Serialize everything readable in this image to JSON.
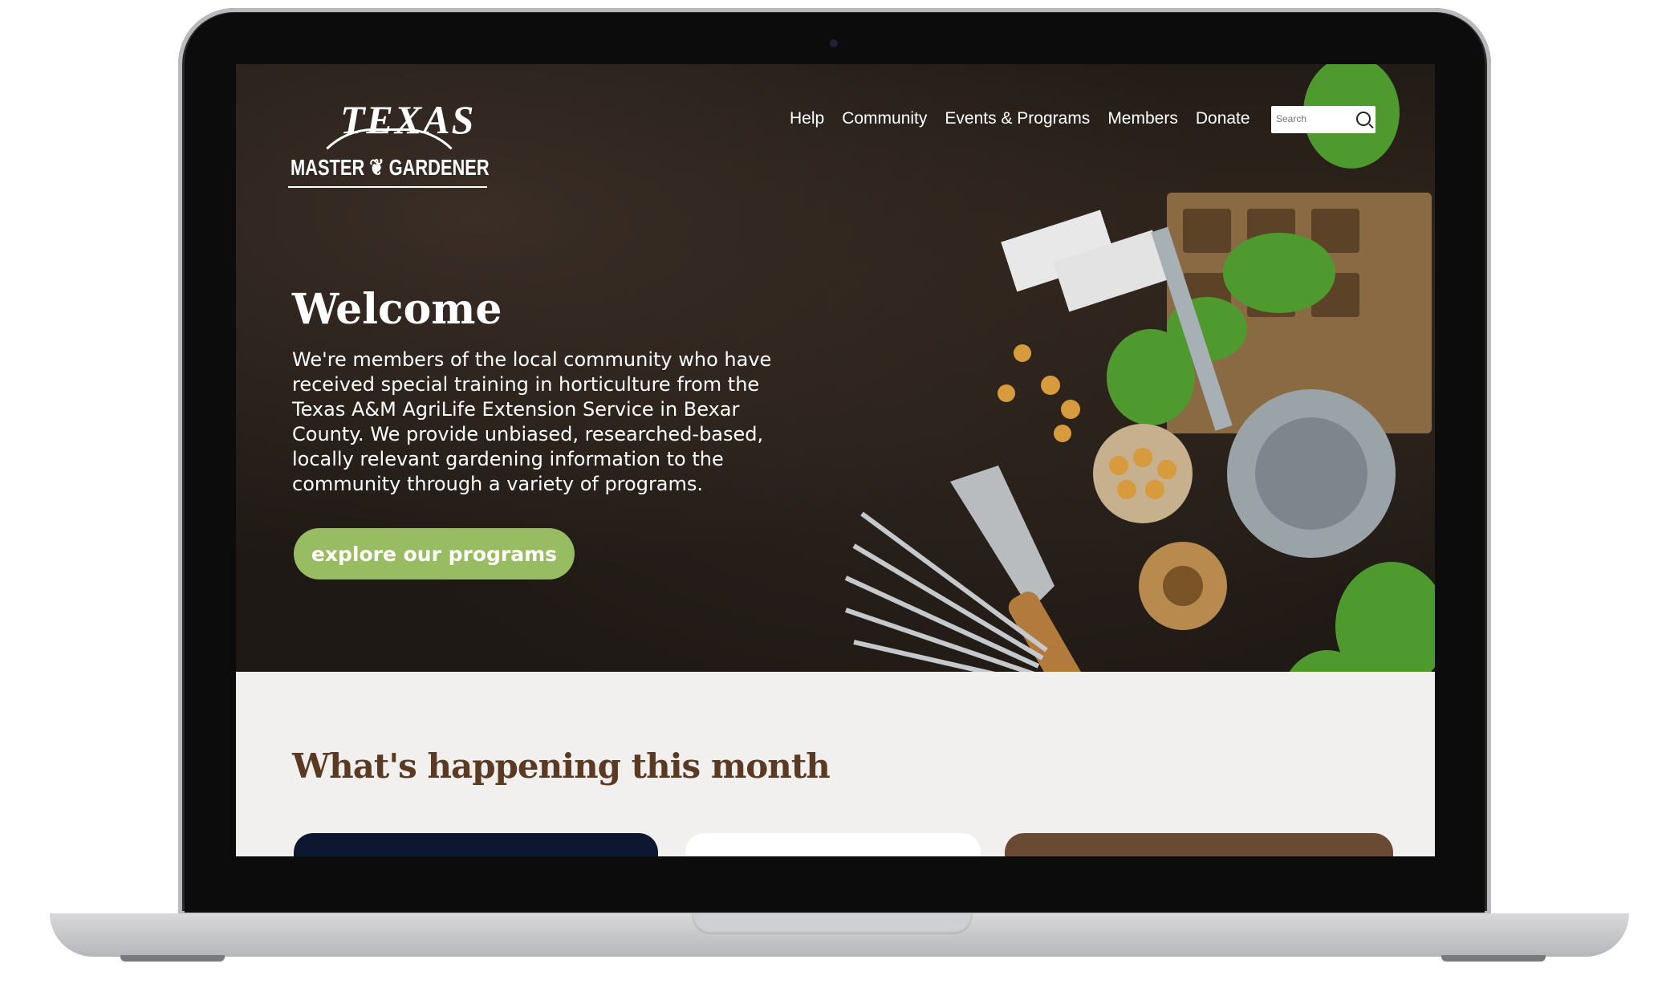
{
  "logo": {
    "top": "TEXAS",
    "bottom": "MASTER ❦ GARDENER"
  },
  "nav": {
    "items": [
      "Help",
      "Community",
      "Events & Programs",
      "Members",
      "Donate"
    ]
  },
  "search": {
    "placeholder": "Search"
  },
  "hero": {
    "title": "Welcome",
    "text": "We're members of the local community who have received special training in horticulture from the Texas A&M AgriLife Extension Service in Bexar County. We provide unbiased, researched-based, locally relevant gardening information to the community through a variety of programs.",
    "cta": "explore our programs"
  },
  "section": {
    "title": "What's happening this month"
  },
  "colors": {
    "accent": "#98bc62",
    "heading": "#5a3a22",
    "soil": "#1f1915"
  }
}
